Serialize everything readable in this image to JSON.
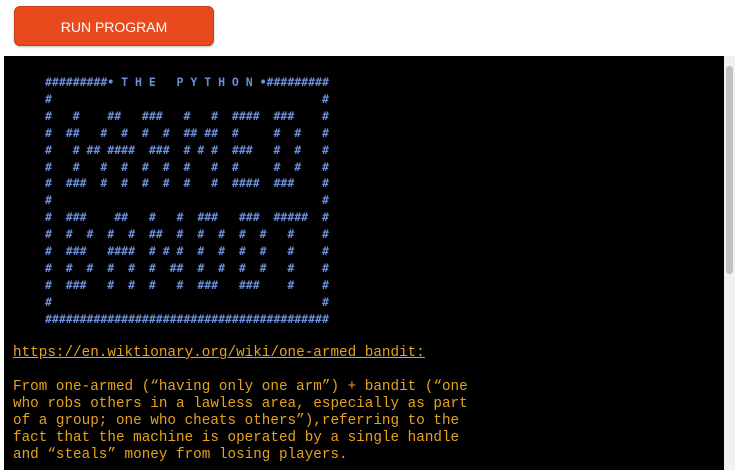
{
  "toolbar": {
    "run_button_label": "RUN PROGRAM"
  },
  "terminal": {
    "banner_lines": [
      "#########• T H E   P Y T H O N •#########",
      "#                                       #",
      "#   #    ##   ###   #   #  ####  ###    #",
      "#  ##   #  #  #  #  ## ##  #     #  #   #",
      "#   # ## ####  ###  # # #  ###   #  #   #",
      "#   #   #  #  #  #  #   #  #     #  #   #",
      "#  ###  #  #  #  #  #   #  ####  ###    #",
      "#                                       #",
      "#  ###    ##   #   #  ###   ###  #####  #",
      "#  #  #  #  #  ##  #  #  #  #  #   #    #",
      "#  ###   ####  # # #  #  #  #  #   #    #",
      "#  #  #  #  #  #  ##  #  #  #  #   #    #",
      "#  ###   #  #  #   #  ###   ###    #    #",
      "#                                       #",
      "#########################################"
    ],
    "link_text": "https://en.wiktionary.org/wiki/one-armed_bandit:",
    "description_lines": [
      "From one-armed (“having only one arm”) + bandit (“one",
      "who robs others in a lawless area, especially as part",
      "of a group; one who cheats others”),referring to the",
      "fact that the machine is operated by a single handle",
      "and “steals” money from losing players."
    ]
  },
  "colors": {
    "run_button": "#e8491d",
    "terminal_background": "#000000",
    "banner_text": "#6a8ed8",
    "output_text": "#e6a21c"
  }
}
